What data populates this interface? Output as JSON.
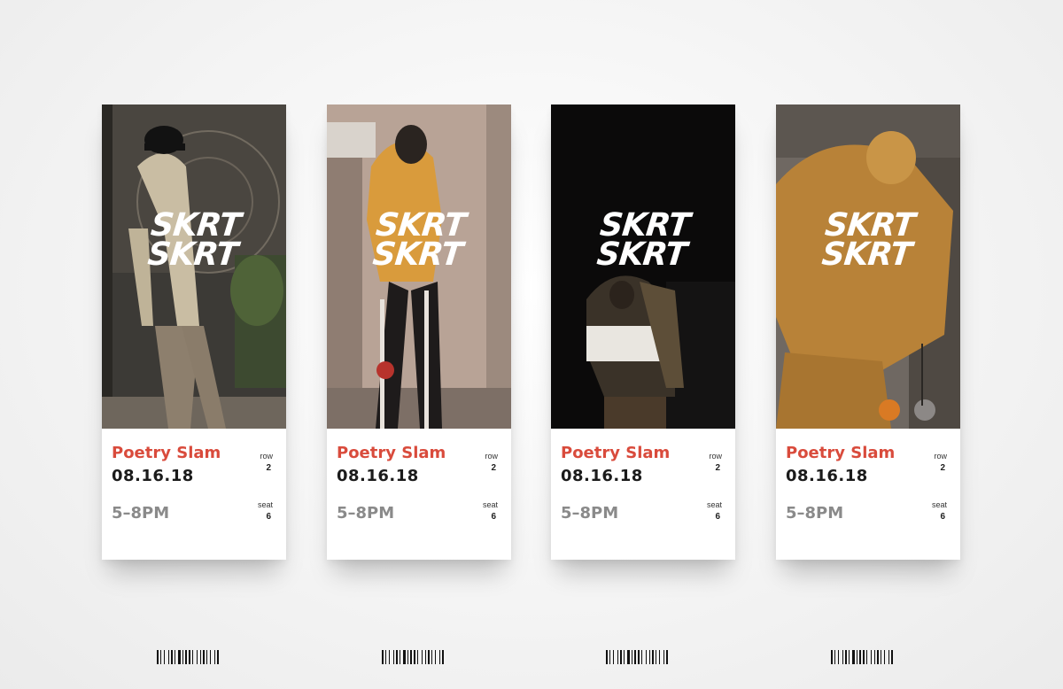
{
  "tickets": [
    {
      "logo_line1": "SKRT",
      "logo_line2": "SKRT",
      "event": "Poetry Slam",
      "date": "08.16.18",
      "time": "5–8PM",
      "row_label": "row",
      "row_value": "2",
      "seat_label": "seat",
      "seat_value": "6"
    },
    {
      "logo_line1": "SKRT",
      "logo_line2": "SKRT",
      "event": "Poetry Slam",
      "date": "08.16.18",
      "time": "5–8PM",
      "row_label": "row",
      "row_value": "2",
      "seat_label": "seat",
      "seat_value": "6"
    },
    {
      "logo_line1": "SKRT",
      "logo_line2": "SKRT",
      "event": "Poetry Slam",
      "date": "08.16.18",
      "time": "5–8PM",
      "row_label": "row",
      "row_value": "2",
      "seat_label": "seat",
      "seat_value": "6"
    },
    {
      "logo_line1": "SKRT",
      "logo_line2": "SKRT",
      "event": "Poetry Slam",
      "date": "08.16.18",
      "time": "5–8PM",
      "row_label": "row",
      "row_value": "2",
      "seat_label": "seat",
      "seat_value": "6"
    }
  ],
  "colors": {
    "event_red": "#d94b3c",
    "date_black": "#1b1b1b",
    "time_gray": "#8a8a8a"
  },
  "icons": [
    "barcode-icon"
  ]
}
